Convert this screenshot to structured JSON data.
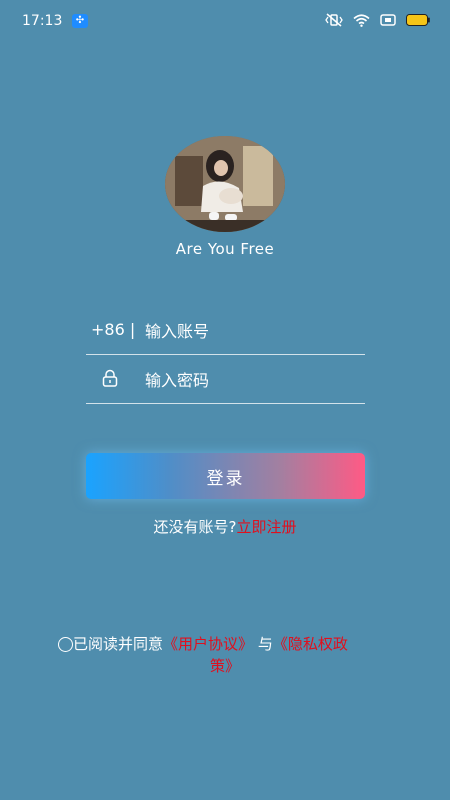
{
  "status_bar": {
    "time": "17:13",
    "notification_icon": "app-notification-icon",
    "icons": [
      "mute-vibrate-icon",
      "wifi-icon",
      "screen-record-icon",
      "battery-icon"
    ],
    "battery_color": "#f5c518"
  },
  "profile": {
    "app_name": "Are You Free"
  },
  "form": {
    "country_code": "+86 |",
    "account_placeholder": "输入账号",
    "password_placeholder": "输入密码",
    "login_label": "登录"
  },
  "register": {
    "prompt": "还没有账号?",
    "link": "立即注册"
  },
  "agreement": {
    "prefix": "已阅读并同意",
    "user_agreement": "《用户协议》",
    "conjunction": "与",
    "privacy_part1": "《隐私权政",
    "privacy_part2": "策》"
  },
  "colors": {
    "background": "#4f8dad",
    "accent_red": "#e0101e",
    "button_gradient": [
      "#1aa3ff",
      "#ff5a85"
    ]
  }
}
